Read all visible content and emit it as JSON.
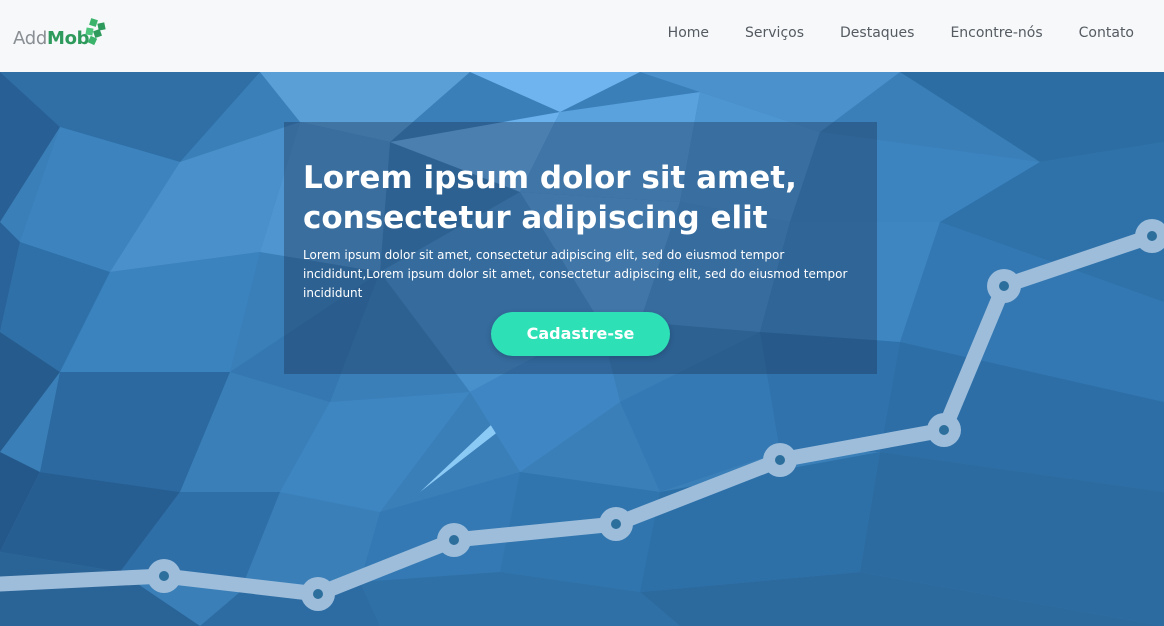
{
  "brand": {
    "name_part1": "Add",
    "name_part2": "Mob"
  },
  "nav": {
    "items": [
      {
        "label": "Home"
      },
      {
        "label": "Serviços"
      },
      {
        "label": "Destaques"
      },
      {
        "label": "Encontre-nós"
      },
      {
        "label": "Contato"
      }
    ]
  },
  "hero": {
    "title_line1": "Lorem ipsum dolor sit amet,",
    "title_line2": "consectetur adipiscing elit",
    "description": "Lorem ipsum dolor sit amet, consectetur adipiscing elit, sed do eiusmod tempor incididunt,Lorem ipsum dolor sit amet, consectetur adipiscing elit, sed do eiusmod tempor incididunt",
    "cta_label": "Cadastre-se"
  },
  "colors": {
    "navbar_bg": "#f6f8fa",
    "nav_text": "#555b61",
    "brand_gray": "#8a8f94",
    "brand_green": "#2e9a5c",
    "hero_blue": "#3a7fb8",
    "cta": "#2ee0b6",
    "trend_line": "#9dbddb"
  },
  "icons": {
    "logo": "green-cubes-icon",
    "trend": "rising-line-chart-graphic"
  }
}
